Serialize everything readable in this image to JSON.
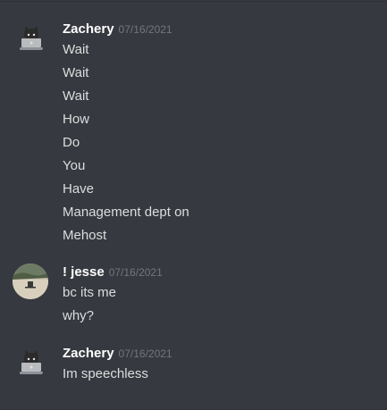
{
  "messages": [
    {
      "author": "Zachery",
      "timestamp": "07/16/2021",
      "lines": [
        "Wait",
        "Wait",
        "Wait",
        "How",
        "Do",
        "You",
        "Have",
        "Management dept on",
        "Mehost"
      ]
    },
    {
      "author": "! jesse",
      "timestamp": "07/16/2021",
      "lines": [
        "bc its me",
        "why?"
      ]
    },
    {
      "author": "Zachery",
      "timestamp": "07/16/2021",
      "lines": [
        "Im speechless"
      ]
    }
  ],
  "colors": {
    "background": "#36393f",
    "username": "#ffffff",
    "timestamp": "#72767d",
    "message_text": "#dcddde"
  }
}
